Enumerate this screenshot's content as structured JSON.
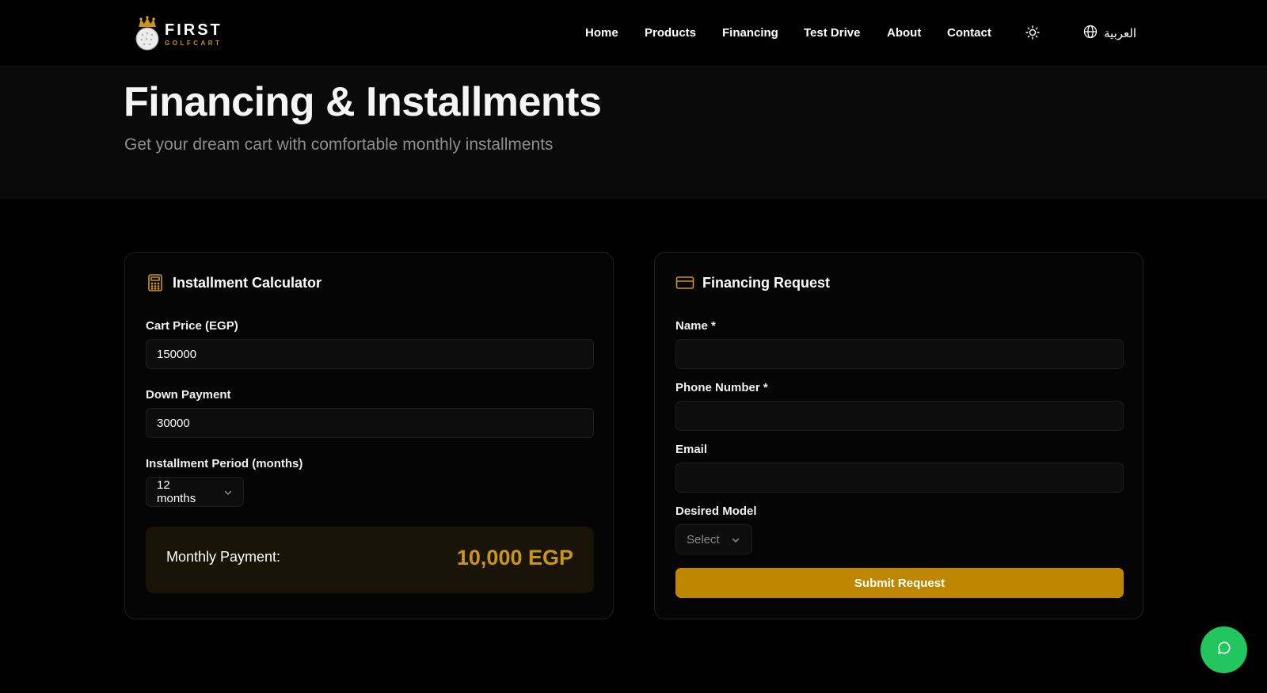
{
  "brand": {
    "name": "FIRST",
    "subname": "GOLFCART",
    "accent_color": "#c9961a"
  },
  "nav": {
    "items": [
      {
        "label": "Home"
      },
      {
        "label": "Products"
      },
      {
        "label": "Financing"
      },
      {
        "label": "Test Drive"
      },
      {
        "label": "About"
      },
      {
        "label": "Contact"
      }
    ],
    "theme_icon": "sun-icon",
    "language_icon": "globe-icon",
    "language_label": "العربية"
  },
  "hero": {
    "title": "Financing & Installments",
    "subtitle": "Get your dream cart with comfortable monthly installments"
  },
  "calculator": {
    "title": "Installment Calculator",
    "icon": "calculator-icon",
    "cart_price_label": "Cart Price (EGP)",
    "cart_price_value": "150000",
    "down_payment_label": "Down Payment",
    "down_payment_value": "30000",
    "period_label": "Installment Period (months)",
    "period_value": "12 months",
    "monthly_label": "Monthly Payment:",
    "monthly_value": "10,000 EGP"
  },
  "request": {
    "title": "Financing Request",
    "icon": "credit-card-icon",
    "name_label": "Name *",
    "name_value": "",
    "phone_label": "Phone Number *",
    "phone_value": "",
    "email_label": "Email",
    "email_value": "",
    "model_label": "Desired Model",
    "model_placeholder": "Select",
    "submit_label": "Submit Request",
    "button_color": "#bf8600"
  },
  "chat": {
    "icon": "chat-bubble-icon",
    "color": "#22c55e"
  }
}
